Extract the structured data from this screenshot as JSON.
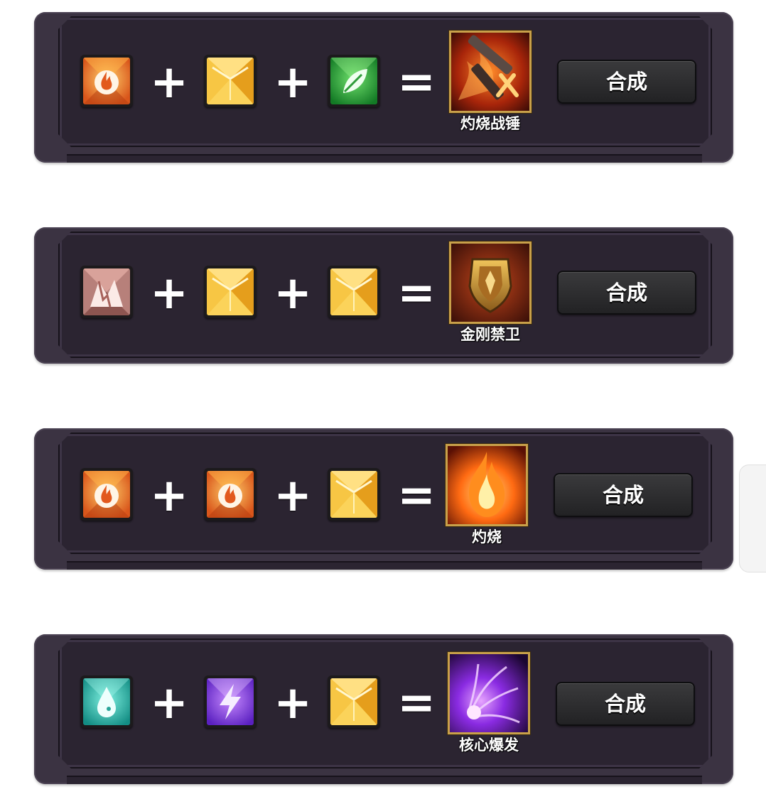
{
  "operators": {
    "plus": "+",
    "equals": "="
  },
  "recipes": [
    {
      "inputs": [
        "fire-gem-icon",
        "gold-gem-icon",
        "green-leaf-gem-icon"
      ],
      "result_icon": "burning-warhammer-icon",
      "result_name": "灼烧战锤",
      "button_label": "合成"
    },
    {
      "inputs": [
        "cracked-stone-gem-icon",
        "gold-gem-icon",
        "gold-gem-icon"
      ],
      "result_icon": "golden-shield-icon",
      "result_name": "金刚禁卫",
      "button_label": "合成"
    },
    {
      "inputs": [
        "fire-gem-icon",
        "fire-gem-icon",
        "gold-gem-icon"
      ],
      "result_icon": "flame-icon",
      "result_name": "灼烧",
      "button_label": "合成"
    },
    {
      "inputs": [
        "water-drop-gem-icon",
        "purple-lightning-gem-icon",
        "gold-gem-icon"
      ],
      "result_icon": "core-burst-icon",
      "result_name": "核心爆发",
      "button_label": "合成"
    }
  ],
  "colors": {
    "panel": "#3b3342",
    "panel_inner": "#2b2431",
    "result_border": "#c8a04a",
    "button": "#2e2e30"
  }
}
